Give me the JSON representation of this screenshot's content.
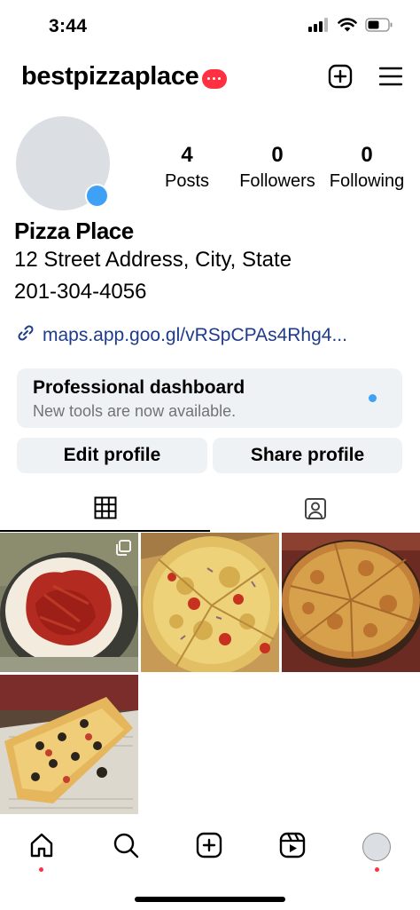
{
  "status_bar": {
    "time": "3:44"
  },
  "header": {
    "username": "bestpizzaplace"
  },
  "profile": {
    "stats": [
      {
        "count": "4",
        "label": "Posts"
      },
      {
        "count": "0",
        "label": "Followers"
      },
      {
        "count": "0",
        "label": "Following"
      }
    ],
    "name": "Pizza Place",
    "address": "12 Street Address, City, State",
    "phone": "201-304-4056",
    "link": "maps.app.goo.gl/vRSpCPAs4Rhg4..."
  },
  "dashboard": {
    "title": "Professional dashboard",
    "subtitle": "New tools are now available."
  },
  "buttons": {
    "edit": "Edit profile",
    "share": "Share profile"
  },
  "tabs": [
    {
      "icon": "grid-icon",
      "active": true
    },
    {
      "icon": "tagged-icon",
      "active": false
    }
  ],
  "posts": [
    {
      "subject": "pizza dough with sauce",
      "carousel": true
    },
    {
      "subject": "sliced pizza with tomato",
      "carousel": false
    },
    {
      "subject": "cheese pizza",
      "carousel": false
    },
    {
      "subject": "olive pizza slices",
      "carousel": false
    }
  ],
  "bottom_nav": [
    "home-icon",
    "search-icon",
    "create-icon",
    "reels-icon",
    "profile-avatar"
  ],
  "colors": {
    "accent_blue": "#3ea1f5",
    "notification_red": "#ff3040",
    "link": "#1e3b8c",
    "button_bg": "#eff2f5"
  }
}
